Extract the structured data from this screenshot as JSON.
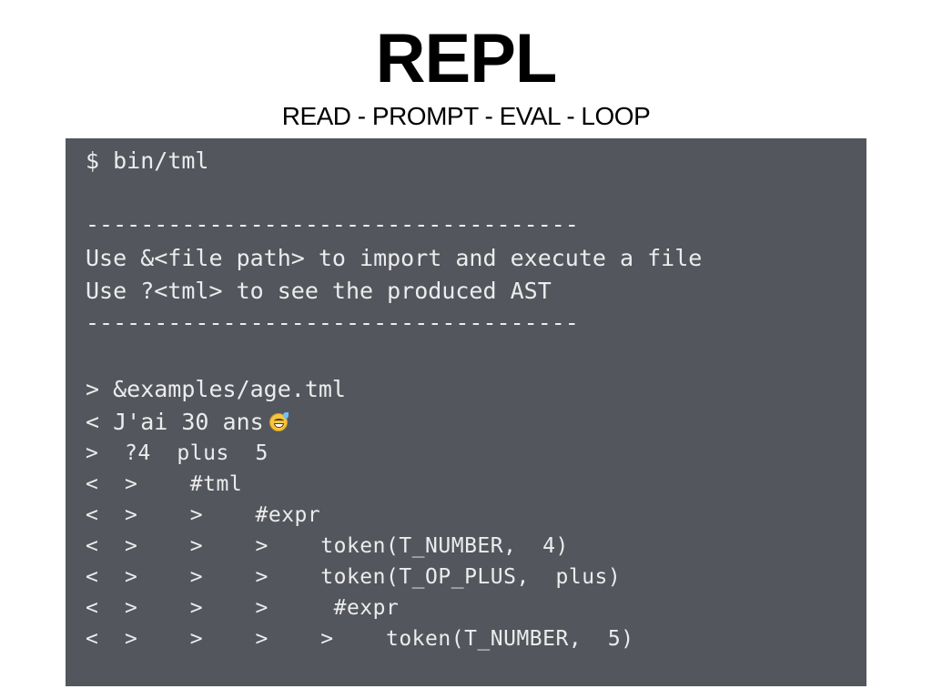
{
  "slide": {
    "title": "REPL",
    "subtitle": "READ - PROMPT - EVAL - LOOP"
  },
  "terminal": {
    "background_color": "#53565d",
    "text_color": "#ececec",
    "lines": [
      "$ bin/tml",
      "------------------------------------",
      "Use &<file path> to import and execute a file",
      "Use ?<tml> to see the produced AST",
      "------------------------------------",
      "> &examples/age.tml",
      "< J'ai 30 ans",
      ">  ?4  plus  5",
      "<  >    #tml",
      "<  >    >    #expr",
      "<  >    >    >    token(T_NUMBER,  4)",
      "<  >    >    >    token(T_OP_PLUS,  plus)",
      "<  >    >    >     #expr",
      "<  >    >    >    >    token(T_NUMBER,  5)"
    ],
    "emoji_icon": "grinning-sweat-emoji-icon"
  }
}
